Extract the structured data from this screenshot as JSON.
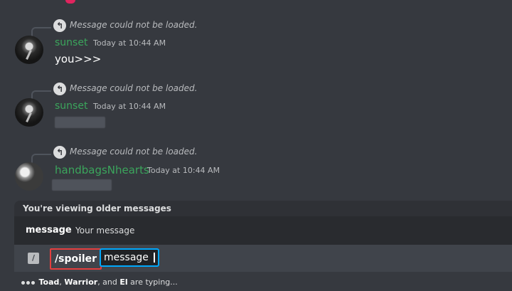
{
  "messages": [
    {
      "reply_text": "Message could not be loaded.",
      "username": "sunset",
      "username_color": "#3ba55c",
      "timestamp": "Today at 10:44 AM",
      "content": "you>>>"
    },
    {
      "reply_text": "Message could not be loaded.",
      "username": "sunset",
      "username_color": "#3ba55c",
      "timestamp": "Today at 10:44 AM",
      "content": ""
    },
    {
      "reply_text": "Message could not be loaded.",
      "username": "handbagsNhearts",
      "username_color": "#3ba55c",
      "timestamp": "Today at 10:44 AM",
      "content": ""
    }
  ],
  "older_banner": "You're viewing older messages",
  "command_option": {
    "name": "message",
    "description": "Your message"
  },
  "composer": {
    "command": "/spoiler",
    "param": "message",
    "highlight_color": "#e53e3e",
    "focus_color": "#00a8fc"
  },
  "typing": {
    "user1": "Toad",
    "user2": "Warrior",
    "user3": "El",
    "suffix": "are typing..."
  }
}
